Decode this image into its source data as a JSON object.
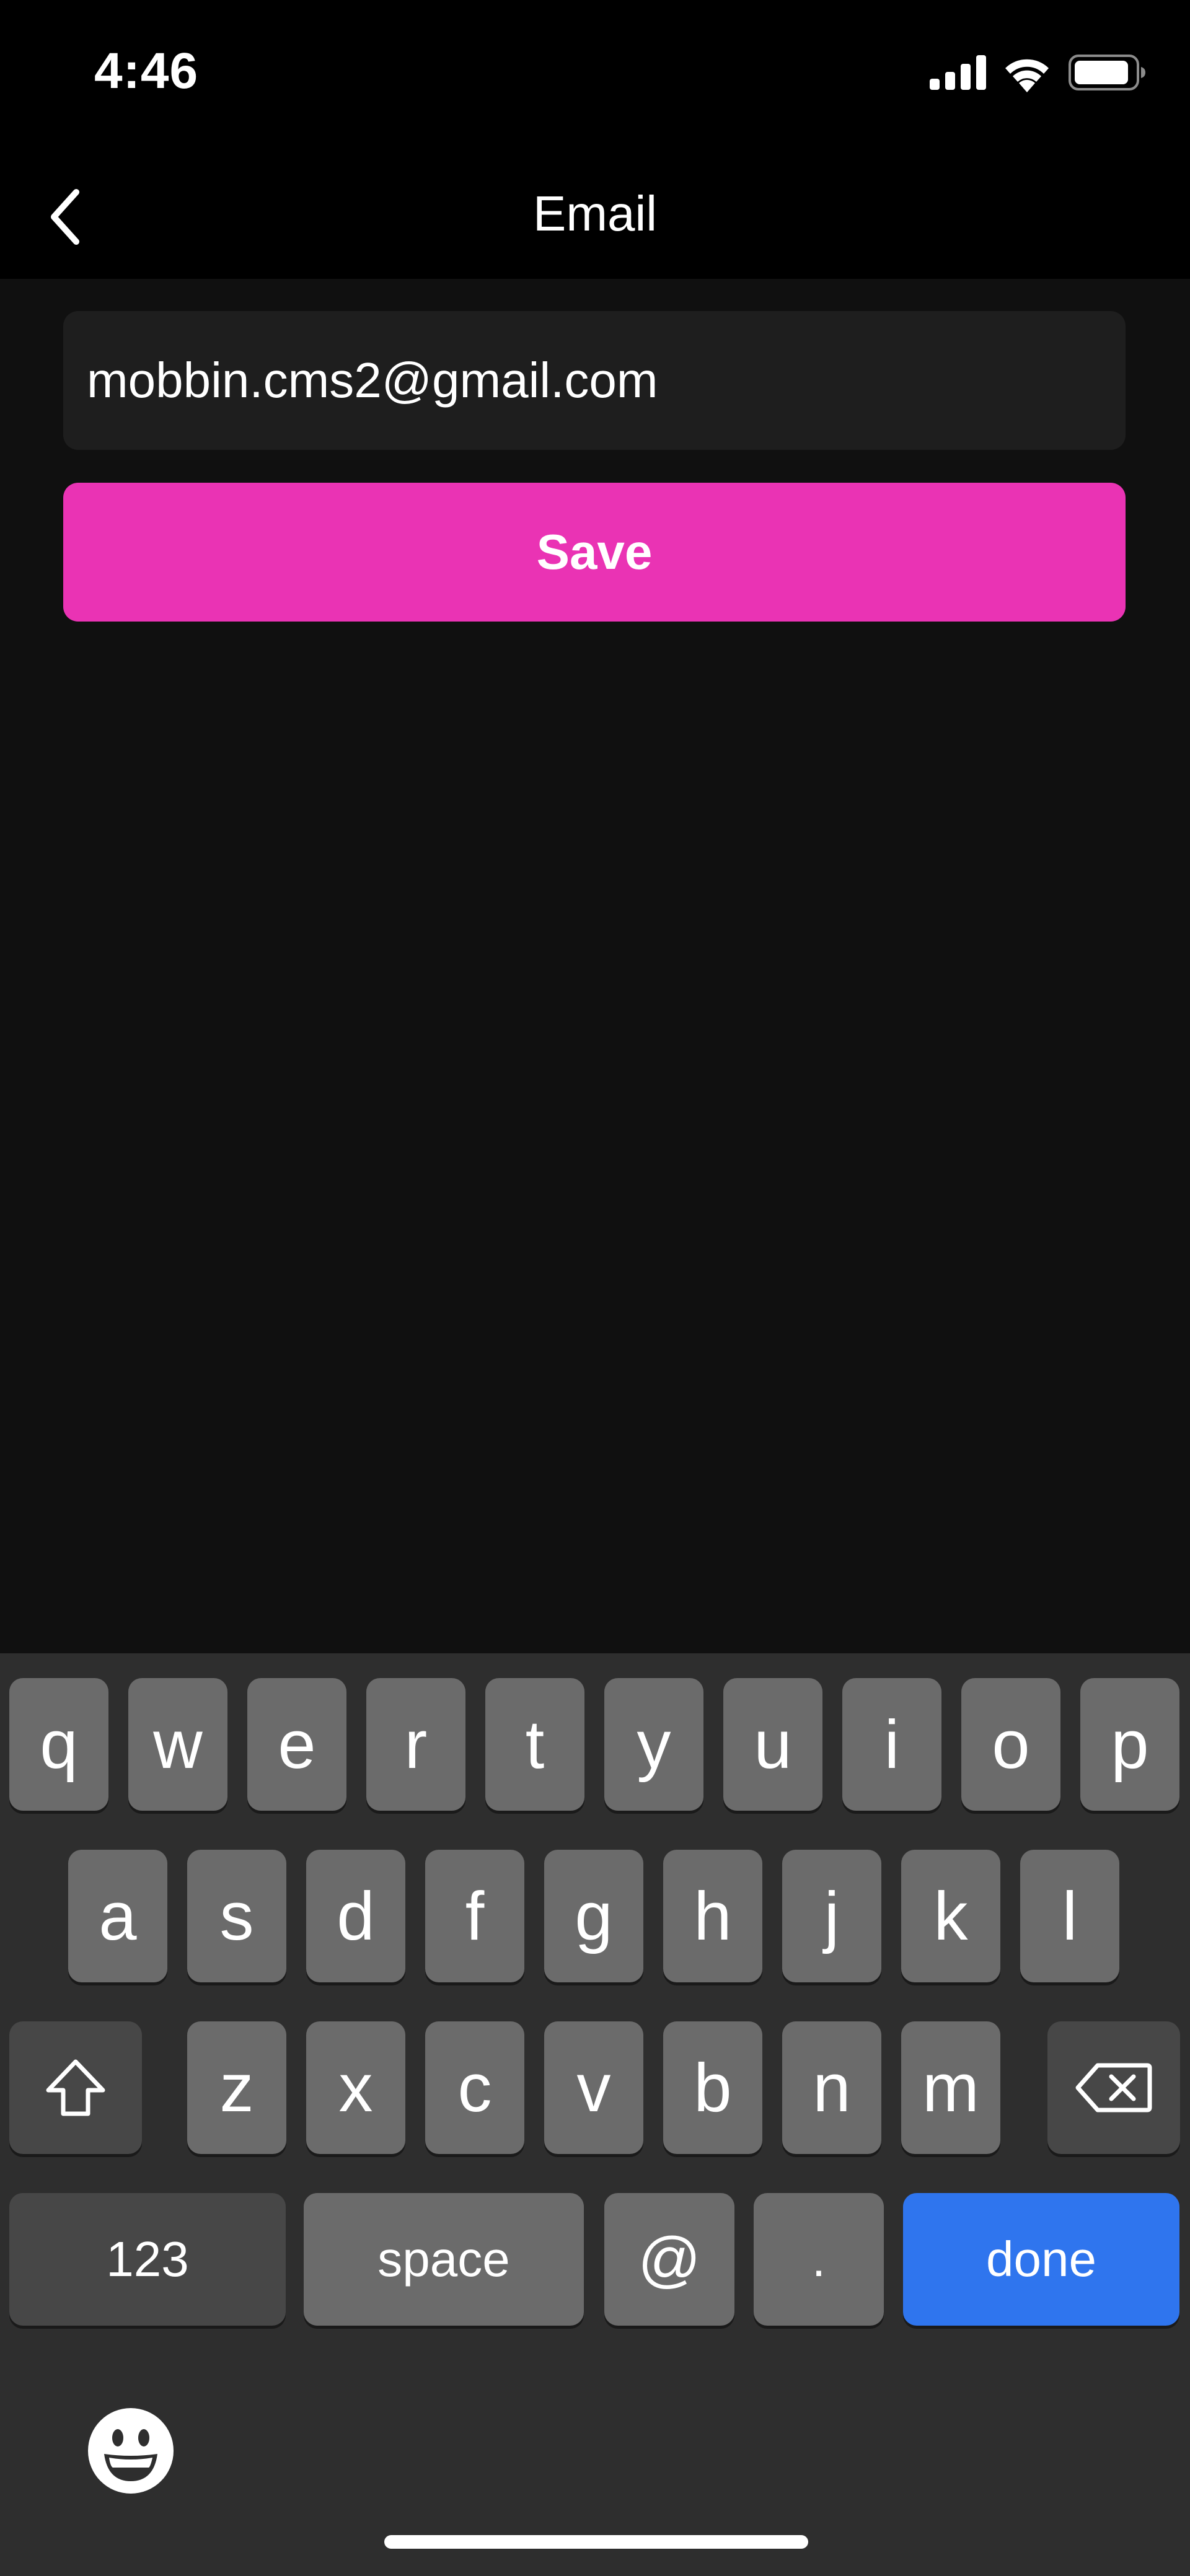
{
  "status_bar": {
    "time": "4:46",
    "icons": [
      "signal-icon",
      "wifi-icon",
      "battery-icon"
    ]
  },
  "nav": {
    "back_icon": "chevron-left-icon",
    "title": "Email"
  },
  "form": {
    "email_value": "mobbin.cms2@gmail.com",
    "save_label": "Save"
  },
  "keyboard": {
    "row1": [
      "q",
      "w",
      "e",
      "r",
      "t",
      "y",
      "u",
      "i",
      "o",
      "p"
    ],
    "row2": [
      "a",
      "s",
      "d",
      "f",
      "g",
      "h",
      "j",
      "k",
      "l"
    ],
    "row3": [
      "z",
      "x",
      "c",
      "v",
      "b",
      "n",
      "m"
    ],
    "shift_icon": "shift-icon",
    "delete_icon": "delete-icon",
    "numbers_label": "123",
    "space_label": "space",
    "at_label": "@",
    "dot_label": ".",
    "done_label": "done",
    "emoji_icon": "emoji-icon"
  },
  "colors": {
    "accent": "#ea33b4",
    "done_key": "#2f75ee",
    "background": "#101010",
    "field_background": "#1e1e1e"
  }
}
